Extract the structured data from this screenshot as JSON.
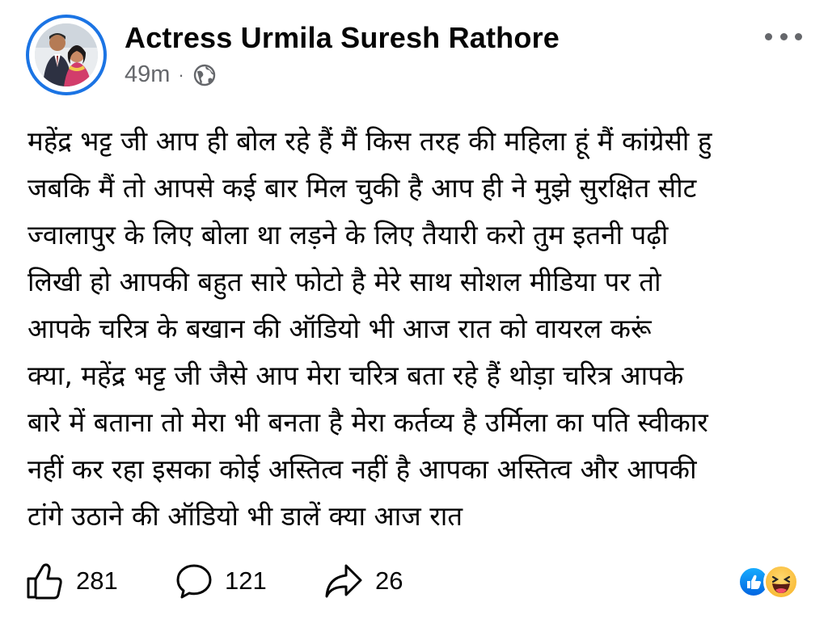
{
  "post": {
    "author": "Actress Urmila Suresh Rathore",
    "time": "49m",
    "separator": "·",
    "audience_icon": "globe-icon",
    "body_lines": [
      "महेंद्र भट्ट जी आप ही बोल रहे हैं मैं किस तरह की महिला हूं मैं कांग्रेसी हु",
      "जबकि मैं तो आपसे कई बार मिल चुकी है आप ही ने मुझे सुरक्षित सीट",
      "ज्वालापुर के लिए बोला था लड़ने के लिए तैयारी करो तुम इतनी पढ़ी",
      "लिखी हो आपकी बहुत सारे फोटो है मेरे साथ सोशल मीडिया पर तो",
      "आपके चरित्र के बखान की ऑडियो भी आज रात को वायरल करूं",
      "क्या, महेंद्र भट्ट जी जैसे आप मेरा चरित्र बता रहे हैं थोड़ा चरित्र आपके",
      "बारे में बताना तो मेरा भी बनता है मेरा कर्तव्य है उर्मिला का पति स्वीकार",
      "नहीं कर रहा इसका कोई अस्तित्व नहीं है आपका अस्तित्व और आपकी",
      "टांगे उठाने की  ऑडियो भी डालें क्या आज रात"
    ]
  },
  "footer": {
    "likes": "281",
    "comments": "121",
    "shares": "26",
    "reaction_icons": [
      "like-reaction-icon",
      "haha-reaction-icon"
    ]
  },
  "colors": {
    "accent": "#1b74e4",
    "secondary_text": "#65676b",
    "text": "#050505"
  }
}
